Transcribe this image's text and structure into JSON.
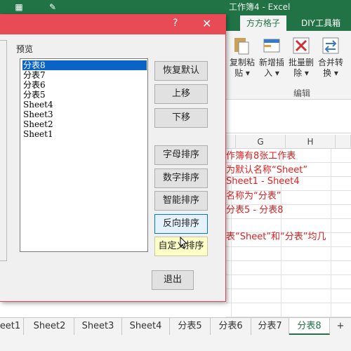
{
  "excel": {
    "title": "工作簿4 - Excel",
    "ribbon_tabs": [
      {
        "label": "方方格子",
        "active": true
      },
      {
        "label": "DIY工具箱",
        "active": false
      }
    ],
    "ribbon_buttons": [
      {
        "label": "复制粘\n贴 ▾",
        "icon": "paste-icon"
      },
      {
        "label": "新增插\n入 ▾",
        "icon": "insert-icon"
      },
      {
        "label": "批量删\n除 ▾",
        "icon": "delete-icon"
      },
      {
        "label": "合并转\n换 ▾",
        "icon": "merge-convert-icon"
      }
    ],
    "group_label": "编辑",
    "col_headers": [
      "G",
      "H"
    ],
    "sheet_text": [
      "作簿有8张工作表",
      "为默认名称“Sheet”",
      "Sheet1 - Sheet4",
      "名称为“分表”",
      "分表5 - 分表8",
      "表“Sheet”和“分表”均几"
    ],
    "sheet_tabs": [
      {
        "label": "eet1",
        "active": false
      },
      {
        "label": "Sheet2",
        "active": false
      },
      {
        "label": "Sheet3",
        "active": false
      },
      {
        "label": "Sheet4",
        "active": false
      },
      {
        "label": "分表5",
        "active": false
      },
      {
        "label": "分表6",
        "active": false
      },
      {
        "label": "分表7",
        "active": false
      },
      {
        "label": "分表8",
        "active": true
      }
    ],
    "add_sheet": "+"
  },
  "dialog": {
    "help": "?",
    "close": "✕",
    "preview_label": "预览",
    "list_items": [
      "分表8",
      "分表7",
      "分表6",
      "分表5",
      "Sheet4",
      "Sheet3",
      "Sheet2",
      "Sheet1"
    ],
    "selected_index": 0,
    "buttons": {
      "restore_default": "恢复默认",
      "move_up": "上移",
      "move_down": "下移",
      "alpha_sort": "字母排序",
      "number_sort": "数字排序",
      "smart_sort": "智能排序",
      "reverse_sort": "反向排序",
      "custom_sort": "自定义排序",
      "exit": "退出"
    }
  },
  "colors": {
    "excel_green": "#217346",
    "dialog_title": "#e84a56",
    "selection_blue": "#0a64c8",
    "annotation_red": "#e02020"
  }
}
